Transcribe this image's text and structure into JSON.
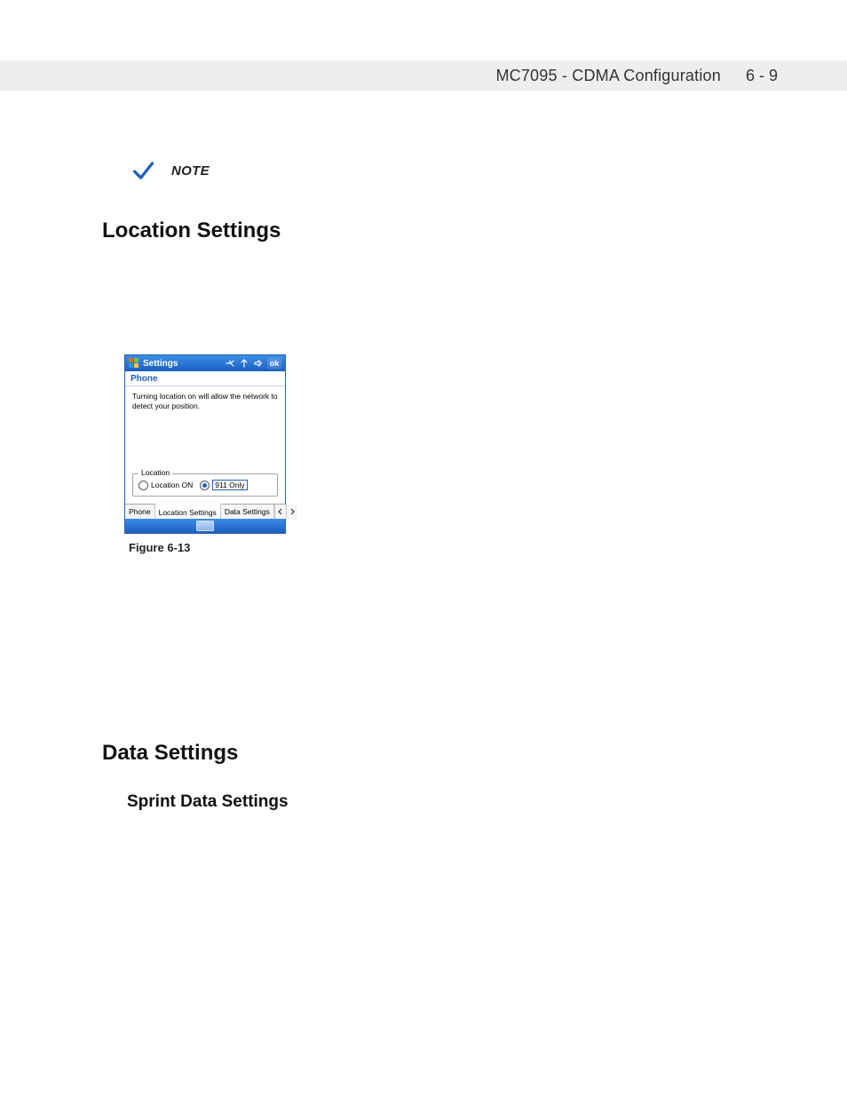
{
  "header": {
    "title": "MC7095 - CDMA Configuration",
    "page": "6 - 9"
  },
  "note": {
    "label": "NOTE"
  },
  "sections": {
    "location": "Location Settings",
    "data": "Data Settings",
    "sprint": "Sprint Data Settings"
  },
  "device": {
    "titlebar": {
      "title": "Settings",
      "ok": "ok",
      "icons": {
        "connectivity": "connectivity-icon",
        "signal": "signal-icon",
        "speaker": "speaker-icon"
      }
    },
    "subtitle": "Phone",
    "description": "Turning location on will allow the network to detect your position.",
    "fieldset": {
      "legend": "Location",
      "options": [
        {
          "label": "Location ON",
          "selected": false
        },
        {
          "label": "911 Only",
          "selected": true
        }
      ]
    },
    "tabs": [
      "Phone",
      "Location Settings",
      "Data Settings"
    ],
    "activeTabIndex": 1,
    "arrows": {
      "left": "◄",
      "right": "►"
    }
  },
  "figure": {
    "caption": "Figure 6-13"
  }
}
